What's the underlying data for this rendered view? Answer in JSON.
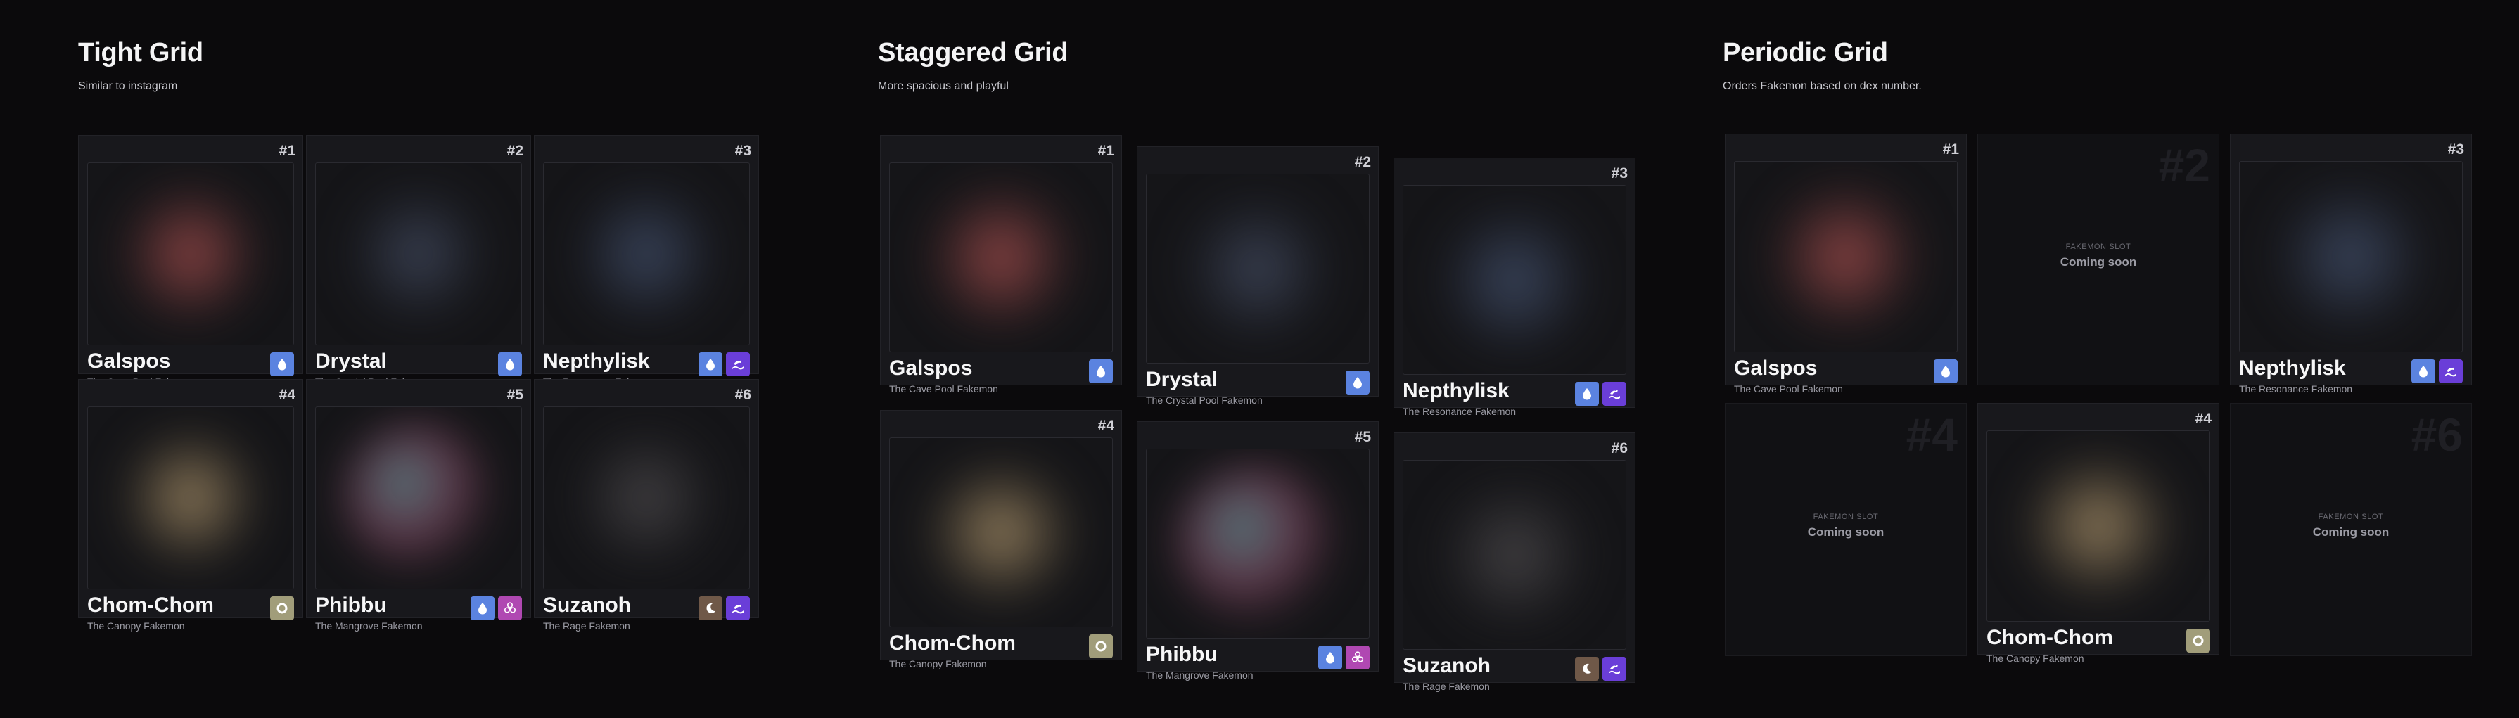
{
  "sections": {
    "tight": {
      "title": "Tight Grid",
      "subtitle": "Similar to instagram"
    },
    "staggered": {
      "title": "Staggered Grid",
      "subtitle": "More spacious and playful"
    },
    "periodic": {
      "title": "Periodic Grid",
      "subtitle": "Orders Fakemon based on dex number."
    }
  },
  "fakemon": {
    "f1": {
      "number": "#1",
      "name": "Galspos",
      "category": "The Cave Pool Fakemon",
      "types": [
        "water"
      ]
    },
    "f2": {
      "number": "#2",
      "name": "Drystal",
      "category": "The Crystal Pool Fakemon",
      "types": [
        "water"
      ]
    },
    "f3": {
      "number": "#3",
      "name": "Nepthylisk",
      "category": "The Resonance Fakemon",
      "types": [
        "water",
        "dragon"
      ]
    },
    "f4": {
      "number": "#4",
      "name": "Chom-Chom",
      "category": "The Canopy Fakemon",
      "types": [
        "normal"
      ]
    },
    "f5": {
      "number": "#5",
      "name": "Phibbu",
      "category": "The Mangrove Fakemon",
      "types": [
        "water",
        "poison"
      ]
    },
    "f6": {
      "number": "#6",
      "name": "Suzanoh",
      "category": "The Rage Fakemon",
      "types": [
        "dark",
        "dragon"
      ]
    }
  },
  "slot": {
    "label": "FAKEMON SLOT",
    "status": "Coming soon"
  },
  "colors": {
    "background": "#0b0a0c",
    "card": "#18181c",
    "water": "#5b83e0",
    "dragon": "#6a3ed8",
    "normal": "#a19d7a",
    "poison": "#b048b2",
    "dark": "#6f5848"
  },
  "icons": {
    "water": "water-drop-icon",
    "dragon": "dragon-wave-icon",
    "normal": "ring-icon",
    "poison": "biohazard-icon",
    "dark": "crescent-moon-icon"
  }
}
